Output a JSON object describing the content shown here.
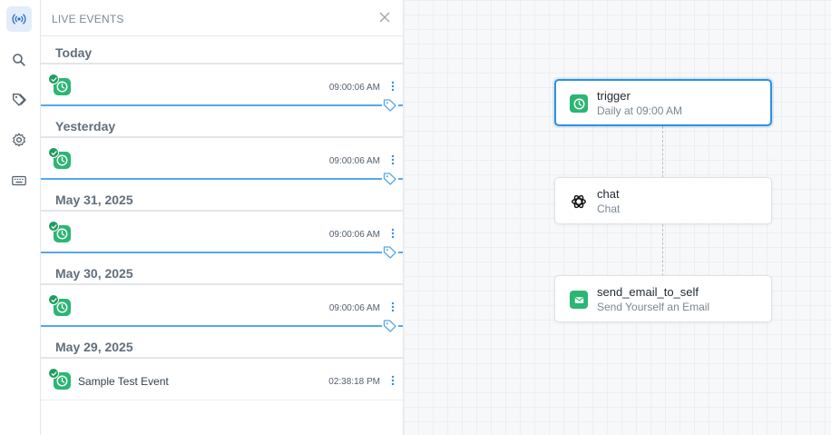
{
  "rail": {
    "items": [
      {
        "name": "live-events-icon",
        "active": true
      },
      {
        "name": "search-icon",
        "active": false
      },
      {
        "name": "tag-icon",
        "active": false
      },
      {
        "name": "gear-icon",
        "active": false
      },
      {
        "name": "keyboard-icon",
        "active": false
      }
    ]
  },
  "panel": {
    "title": "LIVE EVENTS",
    "groups": [
      {
        "date": "Today",
        "events": [
          {
            "name": "",
            "time": "09:00:06 AM",
            "tagged": true
          }
        ]
      },
      {
        "date": "Yesterday",
        "events": [
          {
            "name": "",
            "time": "09:00:06 AM",
            "tagged": true
          }
        ]
      },
      {
        "date": "May 31, 2025",
        "events": [
          {
            "name": "",
            "time": "09:00:06 AM",
            "tagged": true
          }
        ]
      },
      {
        "date": "May 30, 2025",
        "events": [
          {
            "name": "",
            "time": "09:00:06 AM",
            "tagged": true
          }
        ]
      },
      {
        "date": "May 29, 2025",
        "events": [
          {
            "name": "Sample Test Event",
            "time": "02:38:18 PM",
            "tagged": false
          }
        ]
      }
    ]
  },
  "workflow": {
    "nodes": [
      {
        "title": "trigger",
        "subtitle": "Daily at 09:00 AM",
        "icon": "clock-icon",
        "selected": true
      },
      {
        "title": "chat",
        "subtitle": "Chat",
        "icon": "openai-icon",
        "selected": false
      },
      {
        "title": "send_email_to_self",
        "subtitle": "Send Yourself an Email",
        "icon": "mail-icon",
        "selected": false
      }
    ]
  },
  "colors": {
    "accent": "#2d8fe0",
    "success": "#2bb673",
    "tag_line": "#55a8ec"
  }
}
